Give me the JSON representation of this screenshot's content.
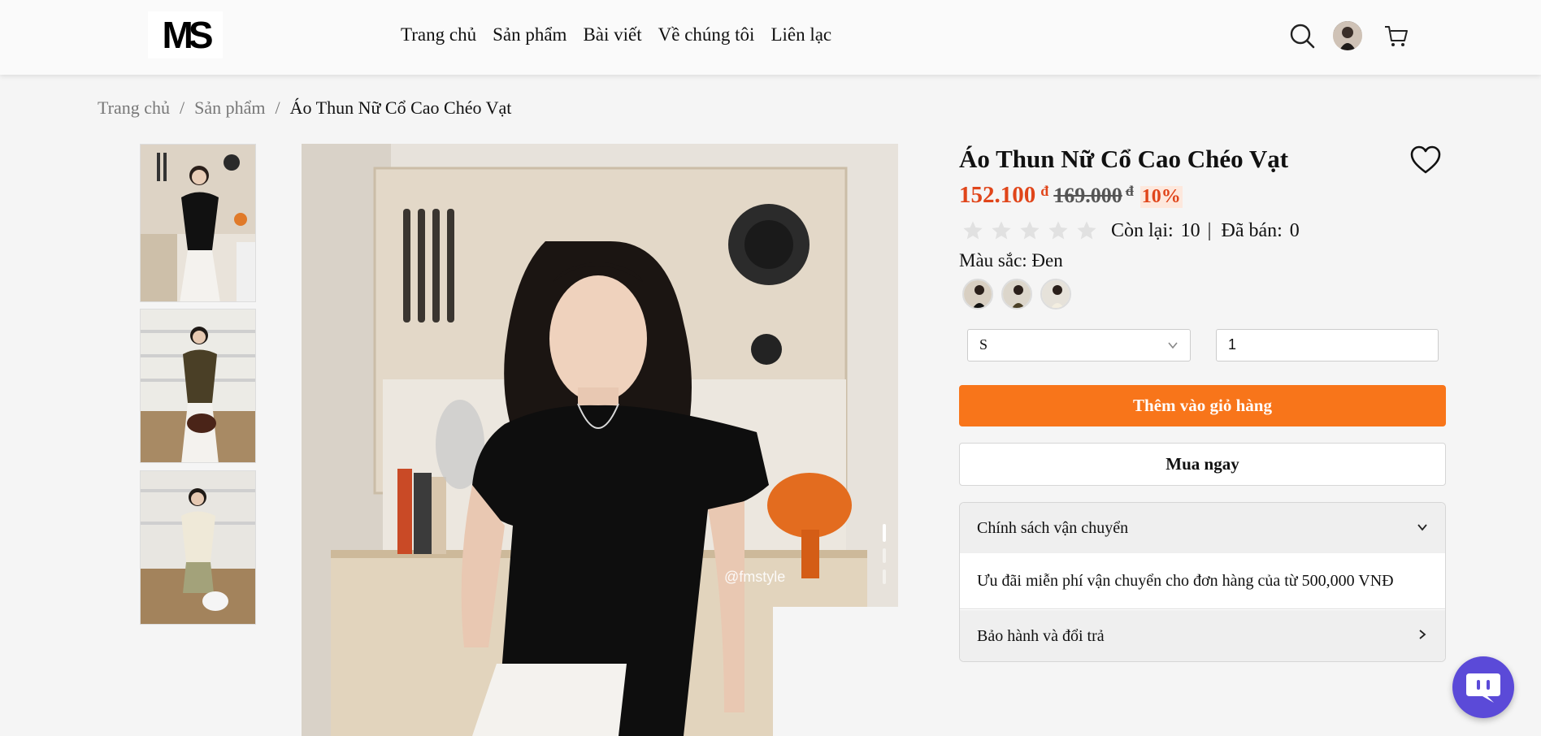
{
  "header": {
    "logo_text": "MS",
    "nav": [
      "Trang chủ",
      "Sản phẩm",
      "Bài viết",
      "Về chúng tôi",
      "Liên lạc"
    ],
    "icons": [
      "search-icon",
      "avatar",
      "cart-icon"
    ]
  },
  "breadcrumb": {
    "items": [
      "Trang chủ",
      "Sản phẩm"
    ],
    "separator": "/",
    "current": "Áo Thun Nữ Cổ Cao Chéo Vạt"
  },
  "gallery": {
    "thumbnails": [
      "black-top",
      "brown-top",
      "cream-top"
    ],
    "watermark": "@fmstyle",
    "slide_index": 1,
    "slide_count": 3
  },
  "product": {
    "title": "Áo Thun Nữ Cổ Cao Chéo Vạt",
    "price": "152.100",
    "currency": "đ",
    "old_price": "169.000",
    "discount": "10%",
    "rating": 0,
    "max_rating": 5,
    "stock_label": "Còn lại:",
    "stock_value": "10",
    "divider": "|",
    "sold_label": "Đã bán:",
    "sold_value": "0",
    "color_label": "Màu sắc: Đen",
    "size_value": "S",
    "quantity_value": "1",
    "add_to_cart": "Thêm vào giỏ hàng",
    "buy_now": "Mua ngay"
  },
  "accordion": {
    "shipping_title": "Chính sách vận chuyển",
    "shipping_body": "Ưu đãi miễn phí vận chuyển cho đơn hàng của từ 500,000 VNĐ",
    "warranty_title": "Bảo hành và đổi trả"
  },
  "colors": {
    "accent": "#f8751a",
    "price": "#e0451a",
    "chat": "#5b4ad8"
  }
}
